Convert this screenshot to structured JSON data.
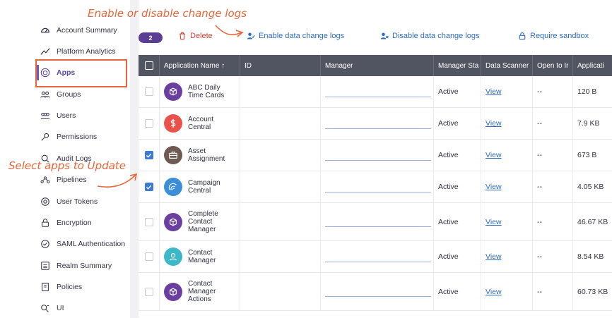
{
  "sidebar": {
    "items": [
      {
        "label": "Account Summary",
        "icon": "dashboard-icon"
      },
      {
        "label": "Platform Analytics",
        "icon": "chart-line-icon"
      },
      {
        "label": "Apps",
        "icon": "apps-icon"
      },
      {
        "label": "Groups",
        "icon": "groups-icon"
      },
      {
        "label": "Users",
        "icon": "users-icon"
      },
      {
        "label": "Permissions",
        "icon": "key-icon"
      },
      {
        "label": "Audit Logs",
        "icon": "audit-icon"
      },
      {
        "label": "Pipelines",
        "icon": "pipelines-icon"
      },
      {
        "label": "User Tokens",
        "icon": "token-icon"
      },
      {
        "label": "Encryption",
        "icon": "lock-icon"
      },
      {
        "label": "SAML Authentication",
        "icon": "saml-icon"
      },
      {
        "label": "Realm Summary",
        "icon": "realm-icon"
      },
      {
        "label": "Policies",
        "icon": "policies-icon"
      },
      {
        "label": "UI",
        "icon": "ui-icon"
      }
    ],
    "active": "Apps"
  },
  "toolbar": {
    "selected_count": "2",
    "delete_label": "Delete",
    "enable_label": "Enable data change logs",
    "disable_label": "Disable data change logs",
    "sandbox_label": "Require sandbox"
  },
  "annotations": {
    "top": "Enable or disable change logs",
    "left": "Select apps to Update"
  },
  "table": {
    "columns": [
      "Application Name ↑",
      "ID",
      "Manager",
      "Manager Sta",
      "Data Scanner",
      "Open to Ir",
      "Applicati"
    ],
    "rows": [
      {
        "name": "ABC Daily Time Cards",
        "status": "Active",
        "scanner": "View",
        "open": "--",
        "size": "120 B",
        "checked": false,
        "icon_color": "#6b3fa0",
        "icon": "cube-icon"
      },
      {
        "name": "Account Central",
        "status": "Active",
        "scanner": "View",
        "open": "--",
        "size": "7.9 KB",
        "checked": false,
        "icon_color": "#e8524a",
        "icon": "dollar-icon"
      },
      {
        "name": "Asset Assignment",
        "status": "Active",
        "scanner": "View",
        "open": "--",
        "size": "673 B",
        "checked": true,
        "icon_color": "#6e5a52",
        "icon": "briefcase-icon"
      },
      {
        "name": "Campaign Central",
        "status": "Active",
        "scanner": "View",
        "open": "--",
        "size": "4.05 KB",
        "checked": true,
        "icon_color": "#3c8ed8",
        "icon": "broadcast-icon"
      },
      {
        "name": "Complete Contact Manager",
        "status": "Active",
        "scanner": "View",
        "open": "--",
        "size": "46.67 KB",
        "checked": false,
        "icon_color": "#6b3fa0",
        "icon": "cube-icon"
      },
      {
        "name": "Contact Manager",
        "status": "Active",
        "scanner": "View",
        "open": "--",
        "size": "8.54 KB",
        "checked": false,
        "icon_color": "#3cb8c8",
        "icon": "person-icon"
      },
      {
        "name": "Contact Manager Actions",
        "status": "Active",
        "scanner": "View",
        "open": "--",
        "size": "60.73 KB",
        "checked": false,
        "icon_color": "#6b3fa0",
        "icon": "cube-icon"
      }
    ]
  },
  "colors": {
    "accent": "#e8673a",
    "link": "#2d6cc0",
    "header_bg": "#515561",
    "badge": "#5b3d95",
    "danger": "#d9433b"
  }
}
